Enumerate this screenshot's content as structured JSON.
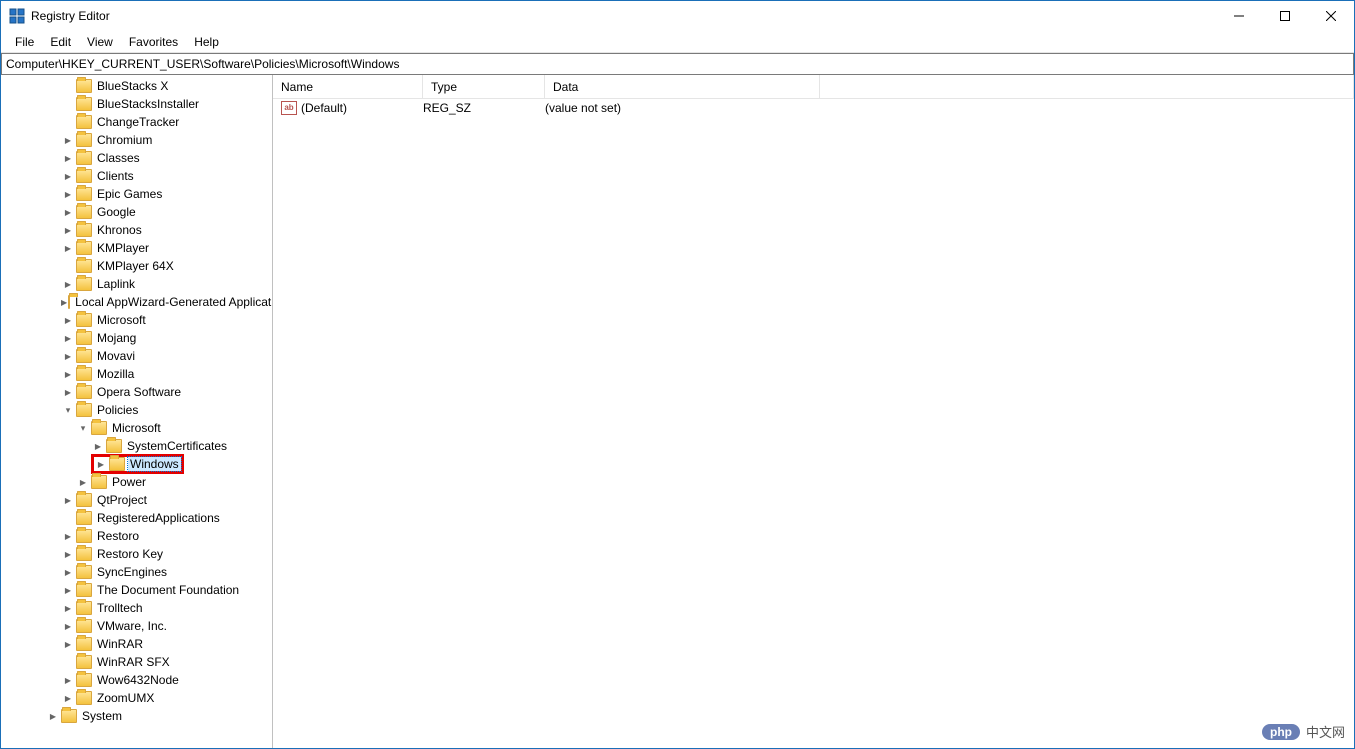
{
  "window": {
    "title": "Registry Editor"
  },
  "menu": {
    "file": "File",
    "edit": "Edit",
    "view": "View",
    "favorites": "Favorites",
    "help": "Help"
  },
  "address": "Computer\\HKEY_CURRENT_USER\\Software\\Policies\\Microsoft\\Windows",
  "tree": [
    {
      "label": "BlueStacks X",
      "indent": 4,
      "expander": "none"
    },
    {
      "label": "BlueStacksInstaller",
      "indent": 4,
      "expander": "none"
    },
    {
      "label": "ChangeTracker",
      "indent": 4,
      "expander": "none"
    },
    {
      "label": "Chromium",
      "indent": 4,
      "expander": "closed"
    },
    {
      "label": "Classes",
      "indent": 4,
      "expander": "closed"
    },
    {
      "label": "Clients",
      "indent": 4,
      "expander": "closed"
    },
    {
      "label": "Epic Games",
      "indent": 4,
      "expander": "closed"
    },
    {
      "label": "Google",
      "indent": 4,
      "expander": "closed"
    },
    {
      "label": "Khronos",
      "indent": 4,
      "expander": "closed"
    },
    {
      "label": "KMPlayer",
      "indent": 4,
      "expander": "closed"
    },
    {
      "label": "KMPlayer 64X",
      "indent": 4,
      "expander": "none"
    },
    {
      "label": "Laplink",
      "indent": 4,
      "expander": "closed"
    },
    {
      "label": "Local AppWizard-Generated Applications",
      "indent": 4,
      "expander": "closed"
    },
    {
      "label": "Microsoft",
      "indent": 4,
      "expander": "closed"
    },
    {
      "label": "Mojang",
      "indent": 4,
      "expander": "closed"
    },
    {
      "label": "Movavi",
      "indent": 4,
      "expander": "closed"
    },
    {
      "label": "Mozilla",
      "indent": 4,
      "expander": "closed"
    },
    {
      "label": "Opera Software",
      "indent": 4,
      "expander": "closed"
    },
    {
      "label": "Policies",
      "indent": 4,
      "expander": "open"
    },
    {
      "label": "Microsoft",
      "indent": 5,
      "expander": "open"
    },
    {
      "label": "SystemCertificates",
      "indent": 6,
      "expander": "closed"
    },
    {
      "label": "Windows",
      "indent": 6,
      "expander": "closed",
      "selected": true,
      "highlighted": true
    },
    {
      "label": "Power",
      "indent": 5,
      "expander": "closed"
    },
    {
      "label": "QtProject",
      "indent": 4,
      "expander": "closed"
    },
    {
      "label": "RegisteredApplications",
      "indent": 4,
      "expander": "none"
    },
    {
      "label": "Restoro",
      "indent": 4,
      "expander": "closed"
    },
    {
      "label": "Restoro Key",
      "indent": 4,
      "expander": "closed"
    },
    {
      "label": "SyncEngines",
      "indent": 4,
      "expander": "closed"
    },
    {
      "label": "The Document Foundation",
      "indent": 4,
      "expander": "closed"
    },
    {
      "label": "Trolltech",
      "indent": 4,
      "expander": "closed"
    },
    {
      "label": "VMware, Inc.",
      "indent": 4,
      "expander": "closed"
    },
    {
      "label": "WinRAR",
      "indent": 4,
      "expander": "closed"
    },
    {
      "label": "WinRAR SFX",
      "indent": 4,
      "expander": "none"
    },
    {
      "label": "Wow6432Node",
      "indent": 4,
      "expander": "closed"
    },
    {
      "label": "ZoomUMX",
      "indent": 4,
      "expander": "closed"
    },
    {
      "label": "System",
      "indent": 3,
      "expander": "closed"
    }
  ],
  "columns": {
    "name": "Name",
    "type": "Type",
    "data": "Data"
  },
  "values": [
    {
      "name": "(Default)",
      "type": "REG_SZ",
      "data": "(value not set)",
      "icon_text": "ab"
    }
  ],
  "watermark": {
    "badge": "php",
    "text": "中文网"
  }
}
